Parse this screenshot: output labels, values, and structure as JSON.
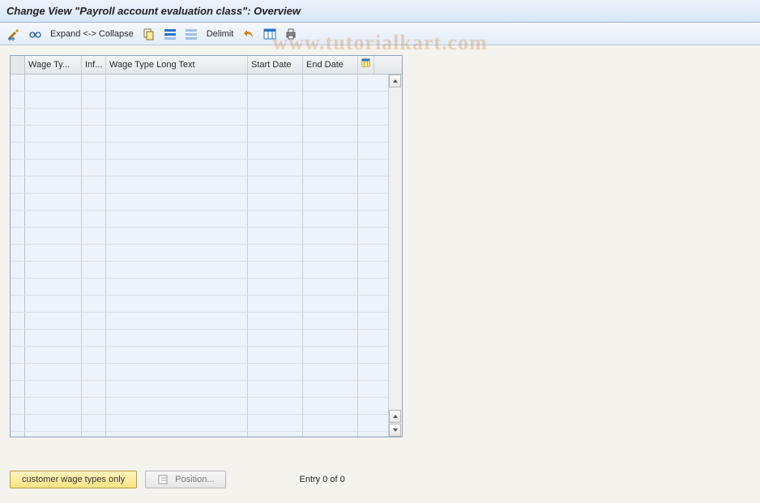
{
  "title": "Change View \"Payroll account evaluation class\": Overview",
  "toolbar": {
    "expand_collapse": "Expand <-> Collapse",
    "delimit": "Delimit"
  },
  "table": {
    "columns": {
      "wage_type": "Wage Ty...",
      "inf": "Inf...",
      "long_text": "Wage Type Long Text",
      "start_date": "Start Date",
      "end_date": "End Date"
    },
    "rows": []
  },
  "footer": {
    "customer_btn": "customer wage types only",
    "position_btn": "Position...",
    "entry_label": "Entry 0 of 0"
  },
  "watermark": "www.tutorialkart.com"
}
